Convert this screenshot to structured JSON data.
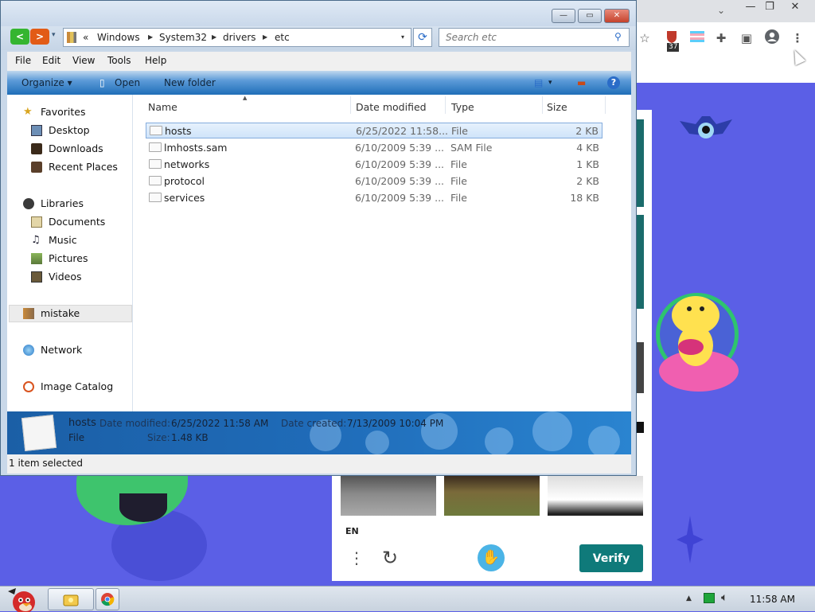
{
  "explorer": {
    "window_controls": {
      "minimize": "—",
      "maximize": "▭",
      "close": "✕"
    },
    "nav": {
      "back": "<",
      "forward": ">",
      "dropdown": "▾"
    },
    "address": {
      "overflow": "«",
      "crumbs": [
        "Windows",
        "System32",
        "drivers",
        "etc"
      ],
      "dropdown": "▾"
    },
    "search": {
      "placeholder": "Search etc"
    },
    "menu": [
      "File",
      "Edit",
      "View",
      "Tools",
      "Help"
    ],
    "commands": {
      "organize": "Organize",
      "open": "Open",
      "new_folder": "New folder",
      "help": "?"
    },
    "nav_pane": [
      {
        "label": "Favorites",
        "icon": "star-icon"
      },
      {
        "label": "Desktop",
        "icon": "desktop-icon"
      },
      {
        "label": "Downloads",
        "icon": "downloads-icon"
      },
      {
        "label": "Recent Places",
        "icon": "recent-places-icon"
      },
      {
        "label": "Libraries",
        "icon": "libraries-icon"
      },
      {
        "label": "Documents",
        "icon": "documents-icon"
      },
      {
        "label": "Music",
        "icon": "music-icon"
      },
      {
        "label": "Pictures",
        "icon": "pictures-icon"
      },
      {
        "label": "Videos",
        "icon": "videos-icon"
      },
      {
        "label": "mistake",
        "icon": "user-folder-icon"
      },
      {
        "label": "Network",
        "icon": "network-icon"
      },
      {
        "label": "Image Catalog",
        "icon": "image-catalog-icon"
      }
    ],
    "columns": [
      "Name",
      "Date modified",
      "Type",
      "Size"
    ],
    "files": [
      {
        "name": "hosts",
        "date": "6/25/2022 11:58...",
        "type": "File",
        "size": "2 KB",
        "selected": true
      },
      {
        "name": "lmhosts.sam",
        "date": "6/10/2009 5:39 ...",
        "type": "SAM File",
        "size": "4 KB"
      },
      {
        "name": "networks",
        "date": "6/10/2009 5:39 ...",
        "type": "File",
        "size": "1 KB"
      },
      {
        "name": "protocol",
        "date": "6/10/2009 5:39 ...",
        "type": "File",
        "size": "2 KB"
      },
      {
        "name": "services",
        "date": "6/10/2009 5:39 ...",
        "type": "File",
        "size": "18 KB"
      }
    ],
    "details": {
      "name": "hosts",
      "date_modified_label": "Date modified:",
      "date_modified": "6/25/2022 11:58 AM",
      "date_created_label": "Date created:",
      "date_created": "7/13/2009 10:04 PM",
      "type": "File",
      "size_label": "Size:",
      "size": "1.48 KB"
    },
    "status": "1 item selected"
  },
  "browser": {
    "extension_badge": "37",
    "window_controls": {
      "minimize": "—",
      "restore": "❐",
      "close": "✕"
    }
  },
  "captcha": {
    "language": "EN",
    "verify_label": "Verify"
  },
  "taskbar": {
    "clock": "11:58 AM"
  },
  "colors": {
    "accent": "#0f7a7a",
    "page_bg": "#5b5fe6",
    "details_bar": "#1f6bb8"
  }
}
